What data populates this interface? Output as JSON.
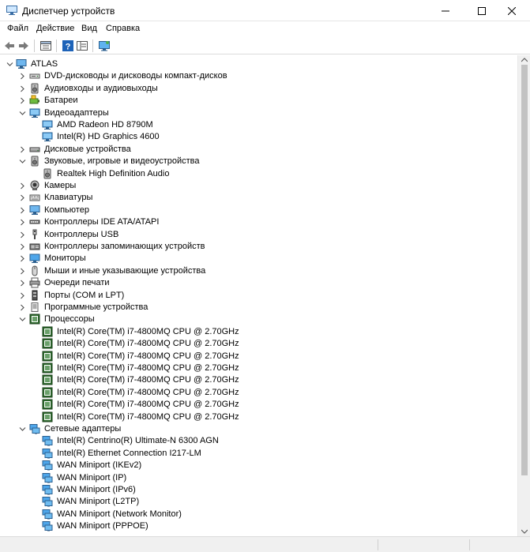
{
  "window": {
    "title": "Диспетчер устройств"
  },
  "menu": [
    {
      "label": "Файл"
    },
    {
      "label": "Действие"
    },
    {
      "label": "Вид"
    },
    {
      "label": "Справка"
    }
  ],
  "toolbar": {
    "icons": [
      "back-icon",
      "forward-icon",
      "properties-icon",
      "help-icon",
      "view-icon",
      "monitor-icon"
    ]
  },
  "tree": {
    "root": "ATLAS",
    "items": [
      {
        "label": "DVD-дисководы и дисководы компакт-дисков",
        "level": 1,
        "expanded": false,
        "icon": "dvd-icon"
      },
      {
        "label": "Аудиовходы и аудиовыходы",
        "level": 1,
        "expanded": false,
        "icon": "speaker-icon"
      },
      {
        "label": "Батареи",
        "level": 1,
        "expanded": false,
        "icon": "battery-icon"
      },
      {
        "label": "Видеоадаптеры",
        "level": 1,
        "expanded": true,
        "icon": "display-adapter-icon"
      },
      {
        "label": "AMD Radeon HD 8790M",
        "level": 2,
        "icon": "display-adapter-icon"
      },
      {
        "label": "Intel(R) HD Graphics 4600",
        "level": 2,
        "icon": "display-adapter-icon"
      },
      {
        "label": "Дисковые устройства",
        "level": 1,
        "expanded": false,
        "icon": "disk-icon"
      },
      {
        "label": "Звуковые, игровые и видеоустройства",
        "level": 1,
        "expanded": true,
        "icon": "speaker-icon"
      },
      {
        "label": "Realtek High Definition Audio",
        "level": 2,
        "icon": "speaker-icon"
      },
      {
        "label": "Камеры",
        "level": 1,
        "expanded": false,
        "icon": "camera-icon"
      },
      {
        "label": "Клавиатуры",
        "level": 1,
        "expanded": false,
        "icon": "keyboard-icon"
      },
      {
        "label": "Компьютер",
        "level": 1,
        "expanded": false,
        "icon": "computer-icon"
      },
      {
        "label": "Контроллеры IDE ATA/ATAPI",
        "level": 1,
        "expanded": false,
        "icon": "ide-icon"
      },
      {
        "label": "Контроллеры USB",
        "level": 1,
        "expanded": false,
        "icon": "usb-icon"
      },
      {
        "label": "Контроллеры запоминающих устройств",
        "level": 1,
        "expanded": false,
        "icon": "storage-controller-icon"
      },
      {
        "label": "Мониторы",
        "level": 1,
        "expanded": false,
        "icon": "monitor-icon"
      },
      {
        "label": "Мыши и иные указывающие устройства",
        "level": 1,
        "expanded": false,
        "icon": "mouse-icon"
      },
      {
        "label": "Очереди печати",
        "level": 1,
        "expanded": false,
        "icon": "printer-icon"
      },
      {
        "label": "Порты (COM и LPT)",
        "level": 1,
        "expanded": false,
        "icon": "port-icon"
      },
      {
        "label": "Программные устройства",
        "level": 1,
        "expanded": false,
        "icon": "software-device-icon"
      },
      {
        "label": "Процессоры",
        "level": 1,
        "expanded": true,
        "icon": "processor-icon"
      },
      {
        "label": "Intel(R) Core(TM) i7-4800MQ CPU @ 2.70GHz",
        "level": 2,
        "icon": "processor-icon"
      },
      {
        "label": "Intel(R) Core(TM) i7-4800MQ CPU @ 2.70GHz",
        "level": 2,
        "icon": "processor-icon"
      },
      {
        "label": "Intel(R) Core(TM) i7-4800MQ CPU @ 2.70GHz",
        "level": 2,
        "icon": "processor-icon"
      },
      {
        "label": "Intel(R) Core(TM) i7-4800MQ CPU @ 2.70GHz",
        "level": 2,
        "icon": "processor-icon"
      },
      {
        "label": "Intel(R) Core(TM) i7-4800MQ CPU @ 2.70GHz",
        "level": 2,
        "icon": "processor-icon"
      },
      {
        "label": "Intel(R) Core(TM) i7-4800MQ CPU @ 2.70GHz",
        "level": 2,
        "icon": "processor-icon"
      },
      {
        "label": "Intel(R) Core(TM) i7-4800MQ CPU @ 2.70GHz",
        "level": 2,
        "icon": "processor-icon"
      },
      {
        "label": "Intel(R) Core(TM) i7-4800MQ CPU @ 2.70GHz",
        "level": 2,
        "icon": "processor-icon"
      },
      {
        "label": "Сетевые адаптеры",
        "level": 1,
        "expanded": true,
        "icon": "network-adapter-icon"
      },
      {
        "label": "Intel(R) Centrino(R) Ultimate-N 6300 AGN",
        "level": 2,
        "icon": "network-adapter-icon"
      },
      {
        "label": "Intel(R) Ethernet Connection I217-LM",
        "level": 2,
        "icon": "network-adapter-icon"
      },
      {
        "label": "WAN Miniport (IKEv2)",
        "level": 2,
        "icon": "network-adapter-icon"
      },
      {
        "label": "WAN Miniport (IP)",
        "level": 2,
        "icon": "network-adapter-icon"
      },
      {
        "label": "WAN Miniport (IPv6)",
        "level": 2,
        "icon": "network-adapter-icon"
      },
      {
        "label": "WAN Miniport (L2TP)",
        "level": 2,
        "icon": "network-adapter-icon"
      },
      {
        "label": "WAN Miniport (Network Monitor)",
        "level": 2,
        "icon": "network-adapter-icon"
      },
      {
        "label": "WAN Miniport (PPPOE)",
        "level": 2,
        "icon": "network-adapter-icon"
      }
    ]
  },
  "colors": {
    "accent": "#0078d7",
    "chevron": "#555555"
  }
}
